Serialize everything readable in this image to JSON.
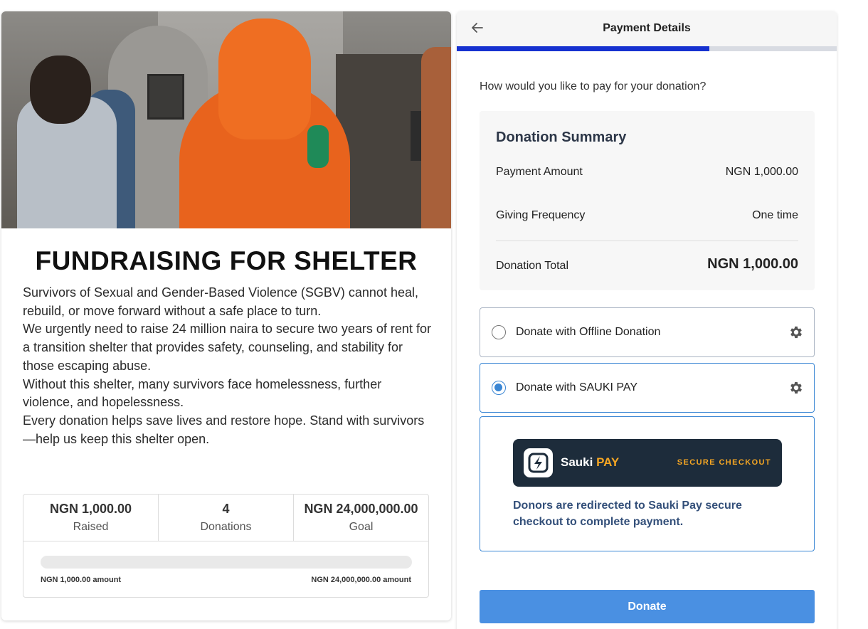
{
  "campaign": {
    "title": "FUNDRAISING FOR SHELTER",
    "story": [
      "Survivors of Sexual and Gender-Based Violence (SGBV) cannot heal, rebuild, or move forward without a safe place to turn.",
      "We urgently need to raise 24 million naira to secure two years of rent for a transition shelter that provides safety, counseling, and stability for those escaping abuse.",
      "Without this shelter, many survivors face homelessness, further violence, and hopelessness.",
      "Every donation helps save lives and restore hope. Stand with survivors—help us keep this shelter open."
    ],
    "stats": {
      "raised_value": "NGN 1,000.00",
      "raised_label": "Raised",
      "donations_value": "4",
      "donations_label": "Donations",
      "goal_value": "NGN 24,000,000.00",
      "goal_label": "Goal"
    },
    "progress": {
      "fraction": 4.17e-05,
      "min_label": "NGN 1,000.00 amount",
      "max_label": "NGN 24,000,000.00 amount"
    }
  },
  "payment": {
    "header_title": "Payment Details",
    "back_icon": "arrow-left-icon",
    "step_progress_fraction": 0.665,
    "question": "How would you like to pay for your donation?",
    "summary": {
      "title": "Donation Summary",
      "payment_amount_label": "Payment Amount",
      "payment_amount_value": "NGN 1,000.00",
      "frequency_label": "Giving Frequency",
      "frequency_value": "One time",
      "total_label": "Donation Total",
      "total_value": "NGN 1,000.00"
    },
    "options": [
      {
        "label": "Donate with Offline Donation",
        "selected": false,
        "icon": "gear-icon"
      },
      {
        "label": "Donate with SAUKI PAY",
        "selected": true,
        "icon": "gear-icon"
      }
    ],
    "sauki": {
      "brand_name": "Sauki",
      "brand_pay": "PAY",
      "secure_label": "SECURE CHECKOUT",
      "note": "Donors are redirected to Sauki Pay secure checkout to complete payment."
    },
    "donate_label": "Donate",
    "colors": {
      "accent": "#4a90e2",
      "step_fill": "#1631d0",
      "sauki_dark": "#1d2c3b",
      "sauki_orange": "#f5a623",
      "note_text": "#34507a"
    }
  }
}
